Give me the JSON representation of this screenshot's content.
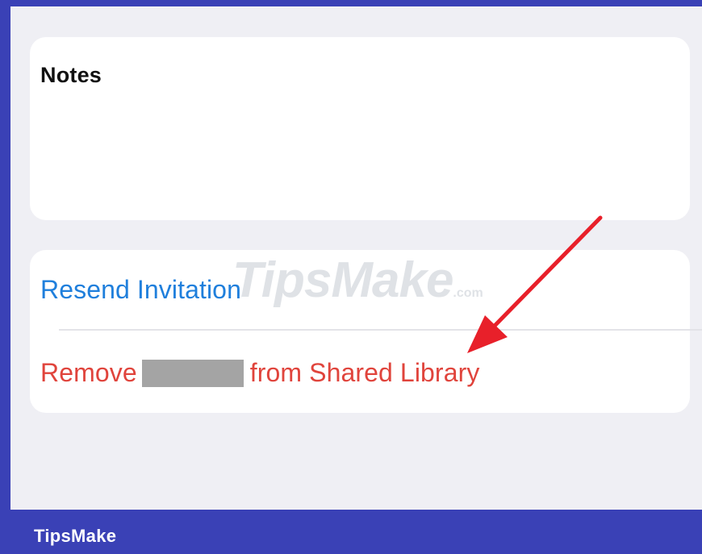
{
  "notes": {
    "title": "Notes"
  },
  "actions": {
    "resend_label": "Resend Invitation",
    "remove_prefix": "Remove",
    "remove_suffix": "from Shared Library"
  },
  "watermark": {
    "text": "TipsMake",
    "suffix": ".com"
  },
  "footer": {
    "brand": "TipsMake"
  },
  "colors": {
    "frame": "#3a41b6",
    "background": "#efeff4",
    "card": "#ffffff",
    "link_blue": "#1f7fdc",
    "destructive_red": "#e0443c",
    "arrow_red": "#e8202a",
    "redaction": "#a4a4a4"
  }
}
